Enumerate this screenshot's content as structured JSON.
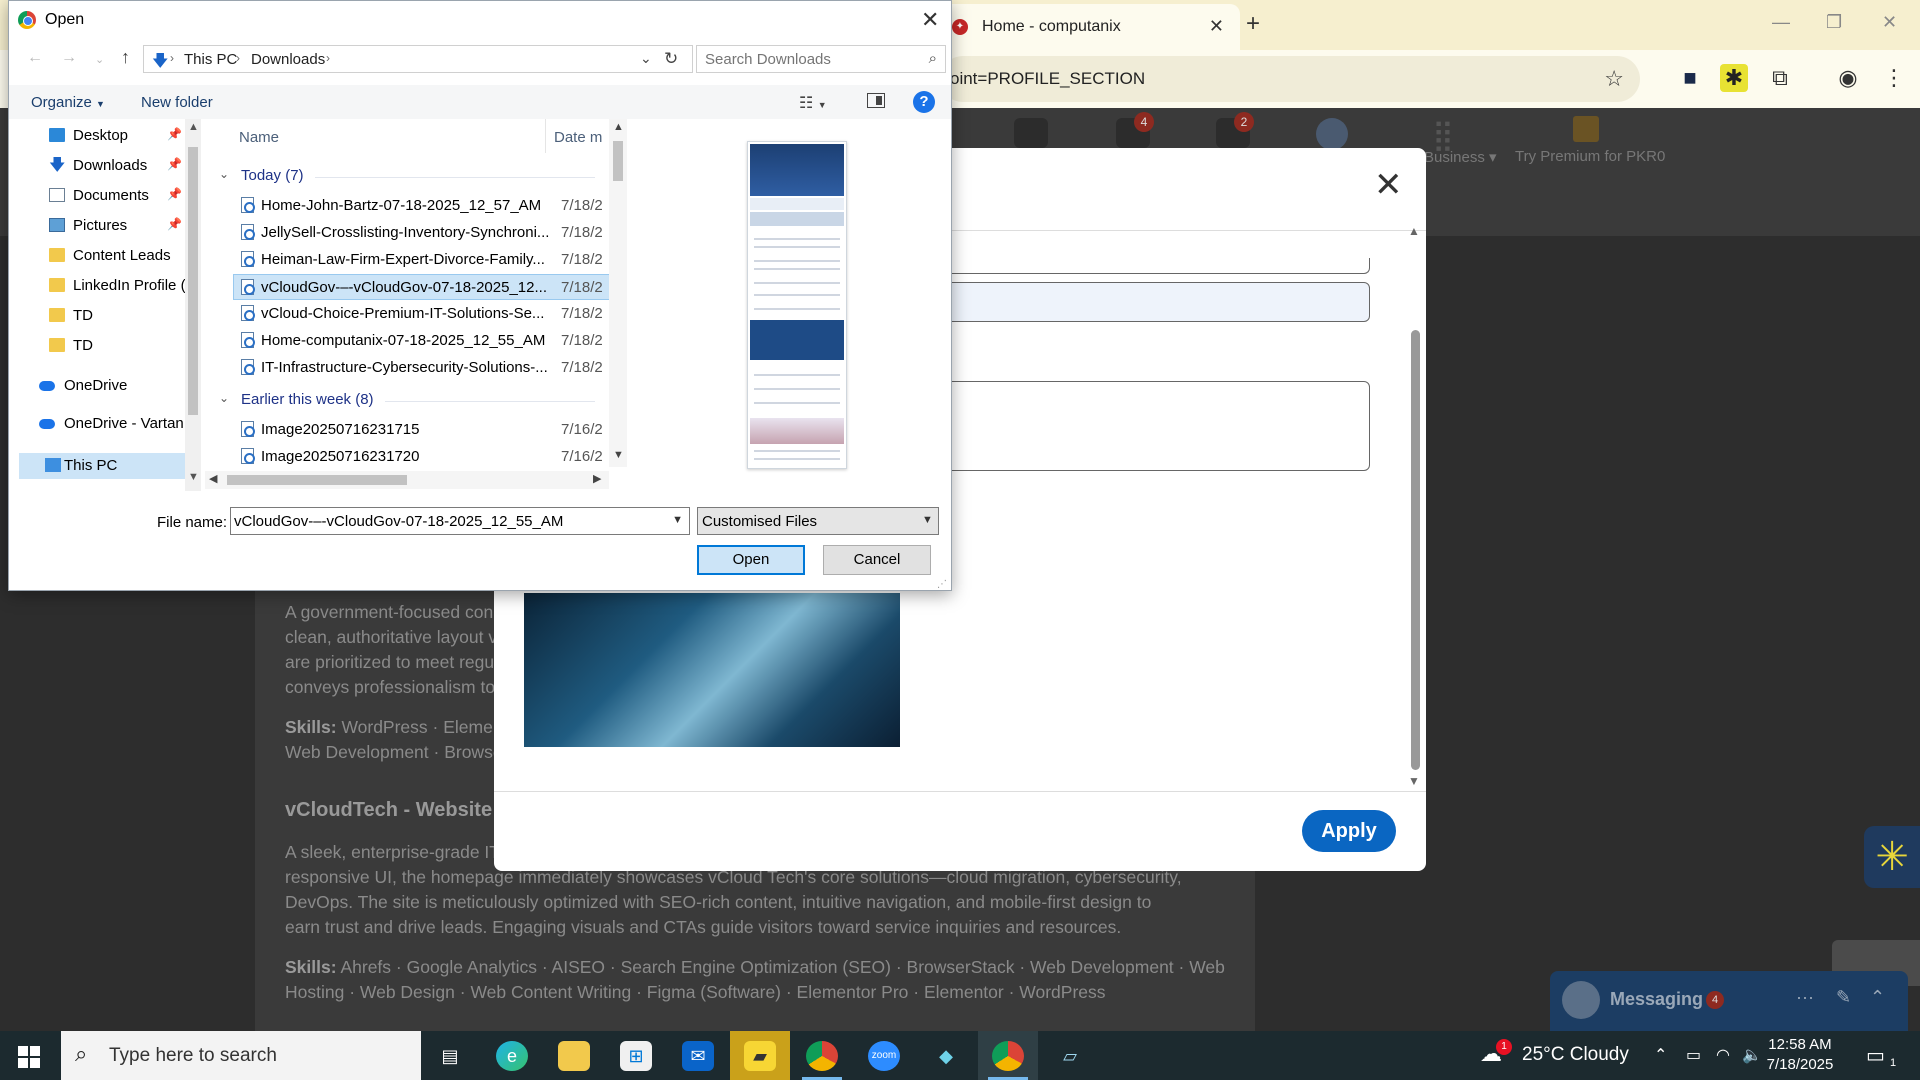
{
  "browser": {
    "tab_title": "Home - computanix",
    "url_fragment": "oint=PROFILE_SECTION"
  },
  "linkedin": {
    "nav_badges": [
      "4",
      "2"
    ],
    "business_label": "Business",
    "premium_label": "Try Premium for PKR0",
    "texts": [
      "A government-focused con",
      "clean, authoritative layout v",
      "are prioritized to meet regu",
      "conveys professionalism to"
    ],
    "skills_1": {
      "label": "Skills:",
      "line1": "WordPress · Elemento",
      "line2": "Web Development · Browse"
    },
    "project_title": "vCloudTech - Website D",
    "desc2": [
      "A sleek, enterprise-grade IT",
      "responsive UI, the homepage immediately showcases vCloud Tech's core solutions—cloud migration, cybersecurity,",
      "DevOps. The site is meticulously optimized with SEO-rich content, intuitive navigation, and mobile-first design to",
      "earn trust and drive leads. Engaging visuals and CTAs guide visitors toward service inquiries and resources."
    ],
    "skills_2": {
      "label": "Skills:",
      "line1": "Ahrefs · Google Analytics · AISEO · Search Engine Optimization (SEO) · BrowserStack · Web Development · Web",
      "line2": "Hosting · Web Design · Web Content Writing · Figma (Software) · Elementor Pro · Elementor · WordPress"
    },
    "apply_label": "Apply",
    "messaging": {
      "label": "Messaging",
      "badge": "4"
    }
  },
  "dialog": {
    "title": "Open",
    "breadcrumb": [
      "This PC",
      "Downloads"
    ],
    "search_placeholder": "Search Downloads",
    "organize_label": "Organize",
    "new_folder_label": "New folder",
    "help_label": "?",
    "nav_items": [
      {
        "label": "Desktop",
        "icon": "desktop-icon",
        "pinned": true
      },
      {
        "label": "Downloads",
        "icon": "download-arrow-icon",
        "pinned": true
      },
      {
        "label": "Documents",
        "icon": "documents-icon",
        "pinned": true
      },
      {
        "label": "Pictures",
        "icon": "pictures-icon",
        "pinned": true
      },
      {
        "label": "Content Leads",
        "icon": "folder-icon",
        "pinned": false
      },
      {
        "label": "LinkedIn Profile (",
        "icon": "folder-icon",
        "pinned": false
      },
      {
        "label": "TD",
        "icon": "folder-icon",
        "pinned": false
      },
      {
        "label": "TD",
        "icon": "folder-icon",
        "pinned": false
      },
      {
        "label": "OneDrive",
        "icon": "cloud-icon",
        "pinned": false
      },
      {
        "label": "OneDrive - Vartan",
        "icon": "cloud-icon",
        "pinned": false
      },
      {
        "label": "This PC",
        "icon": "computer-icon",
        "pinned": false,
        "selected": true
      }
    ],
    "columns": {
      "name": "Name",
      "date": "Date m"
    },
    "groups": [
      {
        "label": "Today (7)",
        "files": [
          {
            "name": "Home-John-Bartz-07-18-2025_12_57_AM",
            "date": "7/18/2"
          },
          {
            "name": "JellySell-Crosslisting-Inventory-Synchroni...",
            "date": "7/18/2"
          },
          {
            "name": "Heiman-Law-Firm-Expert-Divorce-Family...",
            "date": "7/18/2"
          },
          {
            "name": "vCloudGov-–-vCloudGov-07-18-2025_12...",
            "date": "7/18/2",
            "selected": true
          },
          {
            "name": "vCloud-Choice-Premium-IT-Solutions-Se...",
            "date": "7/18/2"
          },
          {
            "name": "Home-computanix-07-18-2025_12_55_AM",
            "date": "7/18/2"
          },
          {
            "name": "IT-Infrastructure-Cybersecurity-Solutions-...",
            "date": "7/18/2"
          }
        ]
      },
      {
        "label": "Earlier this week (8)",
        "files": [
          {
            "name": "Image20250716231715",
            "date": "7/16/2"
          },
          {
            "name": "Image20250716231720",
            "date": "7/16/2"
          }
        ]
      }
    ],
    "file_name_label": "File name:",
    "file_name_value": "vCloudGov-–-vCloudGov-07-18-2025_12_55_AM",
    "file_type": "Customised Files",
    "open_label": "Open",
    "cancel_label": "Cancel"
  },
  "taskbar": {
    "search_placeholder": "Type here to search",
    "weather_badge": "1",
    "weather": "25°C  Cloudy",
    "time": "12:58 AM",
    "date": "7/18/2025",
    "notification_count": "1",
    "apps": [
      "task-view-icon",
      "edge-icon",
      "file-explorer-icon",
      "store-icon",
      "mail-icon",
      "sticky-notes-icon",
      "chrome-icon",
      "zoom-icon",
      "app-icon",
      "chrome-icon",
      "notepad-icon"
    ]
  },
  "colors": {
    "accent": "#0078d7",
    "linkedin_blue": "#0a66c2",
    "selection": "#cce4f7"
  }
}
